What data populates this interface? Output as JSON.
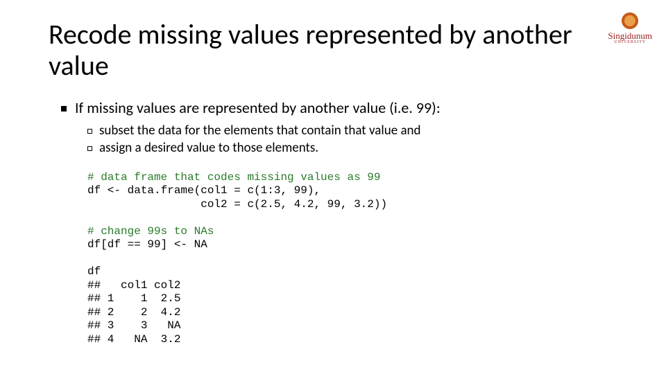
{
  "logo": {
    "name": "Singidunum",
    "sub": "UNIVERSITY"
  },
  "title": "Recode missing values represented by another value",
  "bullets": {
    "l1": "If missing values are represented by another value (i.e. 99):",
    "l2a": "subset the data for the elements that contain that value and",
    "l2b": "assign a desired value to those elements."
  },
  "code": {
    "c1": "# data frame that codes missing values as 99",
    "l1": "df <- data.frame(col1 = c(1:3, 99),",
    "l2": "                 col2 = c(2.5, 4.2, 99, 3.2))",
    "c2": "# change 99s to NAs",
    "l3": "df[df == 99] <- NA",
    "l4": "df",
    "l5": "##   col1 col2",
    "l6": "## 1    1  2.5",
    "l7": "## 2    2  4.2",
    "l8": "## 3    3   NA",
    "l9": "## 4   NA  3.2"
  }
}
